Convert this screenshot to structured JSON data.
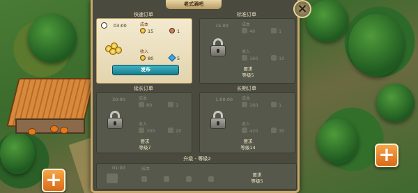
{
  "panel": {
    "title": "老式酒吧",
    "close_icon": "×"
  },
  "orders": [
    {
      "id": "quick",
      "title": "快速订单",
      "unlocked": true,
      "time": "03:00",
      "cost_label": "成本",
      "cost_coins": "15",
      "cost_workers": "1",
      "income_label": "收入",
      "income_coins": "80",
      "income_gems": "5",
      "button": "发布"
    },
    {
      "id": "standard",
      "title": "标准订单",
      "unlocked": false,
      "time": "15:00",
      "cost_label": "成本",
      "cost_coins": "40",
      "cost_workers": "1",
      "income_label": "收入",
      "income_coins": "160",
      "income_gems": "10",
      "requirement": "要求",
      "level": "等级5"
    },
    {
      "id": "extended",
      "title": "延长订单",
      "unlocked": false,
      "time": "30:00",
      "cost_label": "成本",
      "cost_coins": "80",
      "cost_workers": "1",
      "income_label": "收入",
      "income_coins": "300",
      "income_gems": "20",
      "requirement": "要求",
      "level": "等级7"
    },
    {
      "id": "long",
      "title": "长期订单",
      "unlocked": false,
      "time": "1:00:00",
      "cost_label": "成本",
      "cost_coins": "160",
      "cost_workers": "1",
      "income_label": "收入",
      "income_coins": "420",
      "income_gems": "30",
      "requirement": "要求",
      "level": "等级14"
    }
  ],
  "upgrade": {
    "title": "升级 - 等级2",
    "time": "01:00",
    "cost_label": "成本",
    "requirement": "要求",
    "level": "等级5"
  },
  "hud": {
    "left_button": "+",
    "right_button": "+"
  }
}
